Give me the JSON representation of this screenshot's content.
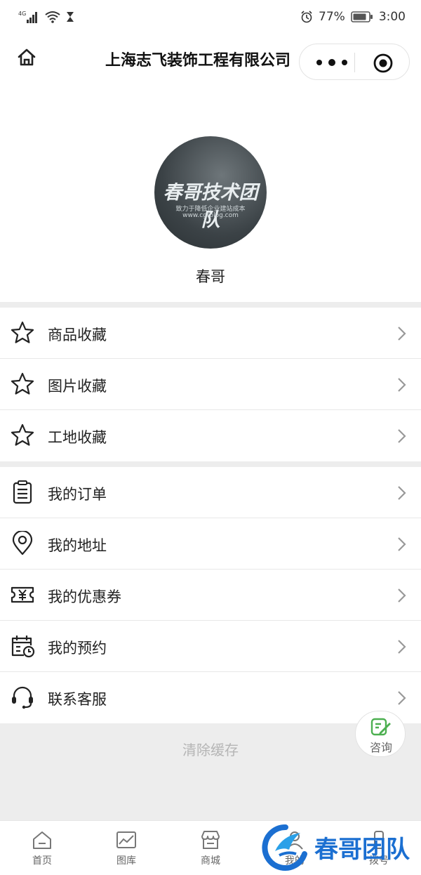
{
  "status_bar": {
    "network": "4G",
    "battery_percent": "77%",
    "time": "3:00"
  },
  "nav": {
    "title": "上海志飞装饰工程有限公司"
  },
  "profile": {
    "avatar_title": "春哥技术团队",
    "avatar_subtitle": "致力于降低企业建站成本",
    "avatar_url_text": "www.cgtblog.com",
    "username": "春哥"
  },
  "favorites": [
    {
      "label": "商品收藏",
      "icon": "star-icon"
    },
    {
      "label": "图片收藏",
      "icon": "star-icon"
    },
    {
      "label": "工地收藏",
      "icon": "star-icon"
    }
  ],
  "menu": [
    {
      "label": "我的订单",
      "icon": "clipboard-icon"
    },
    {
      "label": "我的地址",
      "icon": "location-pin-icon"
    },
    {
      "label": "我的优惠券",
      "icon": "coupon-icon"
    },
    {
      "label": "我的预约",
      "icon": "calendar-clock-icon"
    },
    {
      "label": "联系客服",
      "icon": "headset-icon"
    }
  ],
  "clear_cache_label": "清除缓存",
  "consult_label": "咨询",
  "tabs": [
    {
      "label": "首页",
      "icon": "home-icon"
    },
    {
      "label": "图库",
      "icon": "gallery-icon"
    },
    {
      "label": "商城",
      "icon": "store-icon"
    },
    {
      "label": "我的",
      "icon": "user-icon"
    },
    {
      "label": "拨号",
      "icon": "phone-icon"
    }
  ],
  "watermark": {
    "text": "春哥团队"
  },
  "colors": {
    "accent_green": "#4caf50",
    "watermark_blue": "#1b6fd1"
  }
}
